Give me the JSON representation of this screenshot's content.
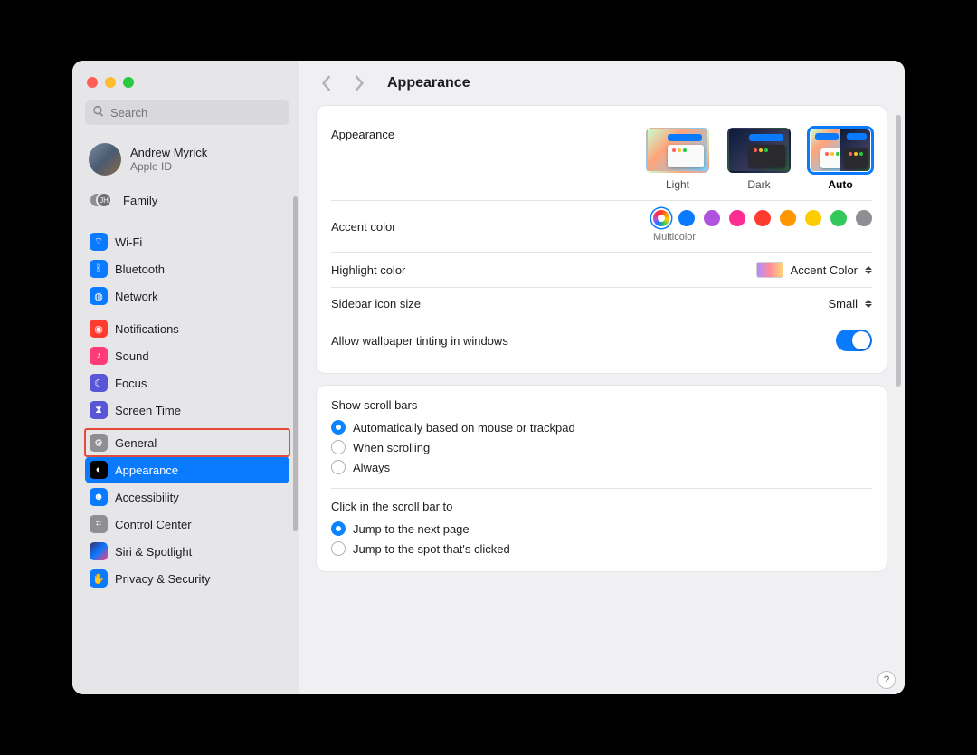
{
  "window": {
    "search_placeholder": "Search",
    "user_name": "Andrew Myrick",
    "user_sub": "Apple ID",
    "family_label": "Family",
    "family_initials": "JH",
    "title": "Appearance",
    "help_glyph": "?"
  },
  "sidebar": {
    "items": [
      {
        "label": "Wi-Fi"
      },
      {
        "label": "Bluetooth"
      },
      {
        "label": "Network"
      },
      {
        "label": "Notifications"
      },
      {
        "label": "Sound"
      },
      {
        "label": "Focus"
      },
      {
        "label": "Screen Time"
      },
      {
        "label": "General"
      },
      {
        "label": "Appearance"
      },
      {
        "label": "Accessibility"
      },
      {
        "label": "Control Center"
      },
      {
        "label": "Siri & Spotlight"
      },
      {
        "label": "Privacy & Security"
      }
    ]
  },
  "appearance": {
    "section_label": "Appearance",
    "options": {
      "light": "Light",
      "dark": "Dark",
      "auto": "Auto"
    },
    "selected": "Auto"
  },
  "accent": {
    "label": "Accent color",
    "selected_label": "Multicolor",
    "colors": [
      "multicolor",
      "#0a7aff",
      "#af52de",
      "#ff2d92",
      "#ff3b30",
      "#ff9500",
      "#ffcc00",
      "#34c759",
      "#8e8e93"
    ]
  },
  "highlight": {
    "label": "Highlight color",
    "value": "Accent Color"
  },
  "sidebar_size": {
    "label": "Sidebar icon size",
    "value": "Small"
  },
  "tint": {
    "label": "Allow wallpaper tinting in windows",
    "value": true
  },
  "scrollbars": {
    "label": "Show scroll bars",
    "options": [
      "Automatically based on mouse or trackpad",
      "When scrolling",
      "Always"
    ],
    "selected_index": 0
  },
  "scrollclick": {
    "label": "Click in the scroll bar to",
    "options": [
      "Jump to the next page",
      "Jump to the spot that's clicked"
    ],
    "selected_index": 0
  }
}
